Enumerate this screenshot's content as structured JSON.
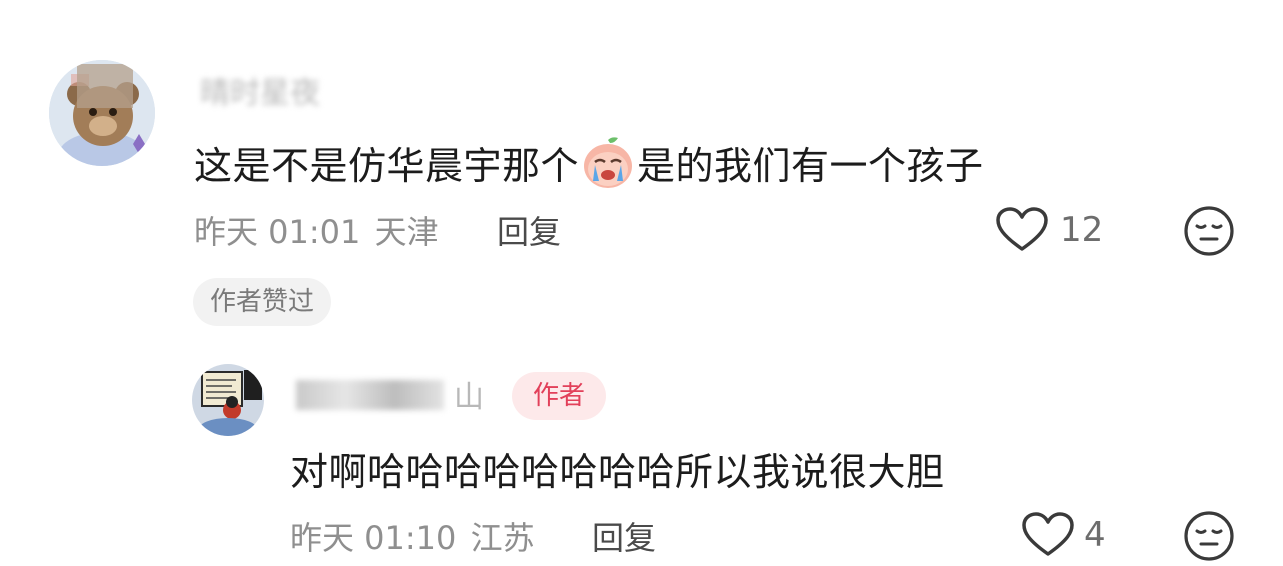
{
  "comments": [
    {
      "username": "晴时星夜",
      "text_before": "这是不是仿华晨宇那个",
      "emoji": "crying-peach-emoji",
      "text_after": "是的我们有一个孩子",
      "time": "昨天 01:01",
      "location": "天津",
      "reply_label": "回复",
      "like_count": "12",
      "author_liked_badge": "作者赞过"
    },
    {
      "username": "山",
      "author_badge": "作者",
      "text": "对啊哈哈哈哈哈哈哈哈所以我说很大胆",
      "time": "昨天 01:10",
      "location": "江苏",
      "reply_label": "回复",
      "like_count": "4"
    }
  ],
  "icons": [
    "heart-outline-icon",
    "neutral-face-icon"
  ],
  "colors": {
    "author_badge_bg": "#fde9ea",
    "author_badge_text": "#e2405a",
    "meta_text": "#8f8f8f",
    "badge_bg": "#f2f2f2"
  }
}
